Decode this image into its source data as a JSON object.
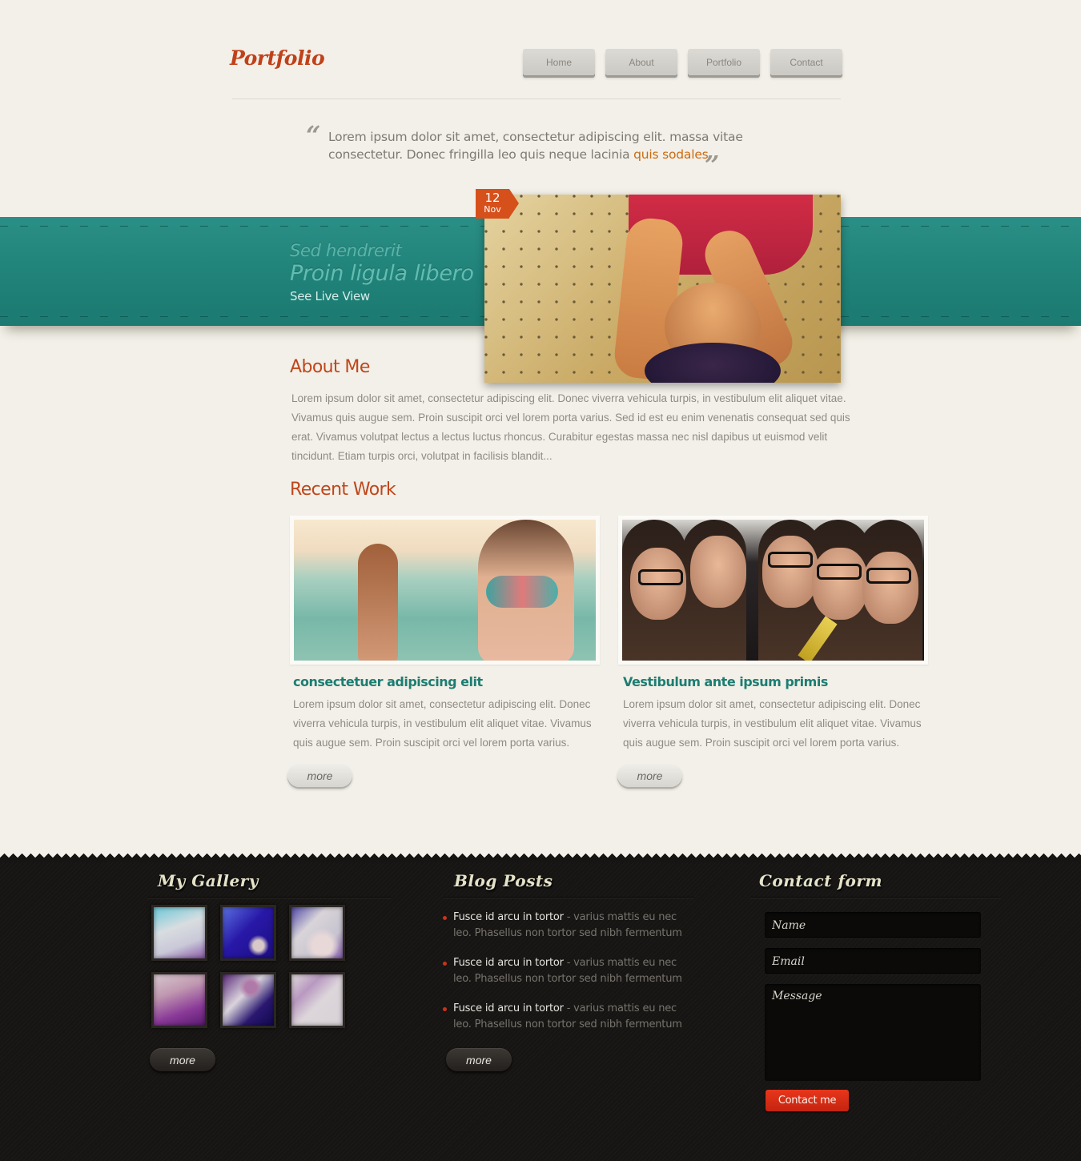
{
  "header": {
    "logo": "Portfolio",
    "nav": [
      {
        "label": "Home"
      },
      {
        "label": "About"
      },
      {
        "label": "Portfolio"
      },
      {
        "label": "Contact"
      }
    ]
  },
  "quote": {
    "open_mark": "“",
    "close_mark": "”",
    "text": "Lorem ipsum dolor sit amet, consectetur adipiscing elit. massa vitae consectetur. Donec fringilla leo quis neque lacinia ",
    "highlight": "quis sodales",
    "highlight_color": "#cc6a10"
  },
  "banner": {
    "subtitle": "Sed hendrerit",
    "title": "Proin ligula libero",
    "link": "See Live View",
    "color": "#1f8178"
  },
  "featured": {
    "date_day": "12",
    "date_month": "Nov",
    "image": "woman-lying-on-bed-with-headphones"
  },
  "about": {
    "title": "About Me",
    "text": "Lorem ipsum dolor sit amet, consectetur adipiscing elit. Donec viverra vehicula turpis, in vestibulum elit aliquet vitae. Vivamus quis augue sem. Proin suscipit orci vel lorem porta varius. Sed id est eu enim venenatis consequat sed quis erat.  Vivamus volutpat lectus a lectus luctus rhoncus. Curabitur egestas massa nec nisl dapibus ut euismod velit tincidunt. Etiam turpis orci, volutpat in facilisis blandit..."
  },
  "recent_work": {
    "title": "Recent Work",
    "items": [
      {
        "image": "two-women-at-beach",
        "title": "consectetuer adipiscing elit",
        "text": "Lorem ipsum dolor sit amet, consectetur adipiscing elit. Donec viverra vehicula turpis, in vestibulum elit aliquet vitae. Vivamus quis augue sem. Proin suscipit orci vel lorem porta varius.",
        "more": "more"
      },
      {
        "image": "group-with-glasses",
        "title": "Vestibulum ante ipsum primis",
        "text": "Lorem ipsum dolor sit amet, consectetur adipiscing elit. Donec viverra vehicula turpis, in vestibulum elit aliquet vitae. Vivamus quis augue sem. Proin suscipit orci vel lorem porta varius.",
        "more": "more"
      }
    ]
  },
  "footer": {
    "gallery": {
      "title": "My Gallery",
      "thumbs": [
        "gallery-1",
        "gallery-2",
        "gallery-3",
        "gallery-4",
        "gallery-5",
        "gallery-6"
      ],
      "more": "more"
    },
    "blog": {
      "title": "Blog Posts",
      "posts": [
        {
          "lead": "Fusce id arcu in tortor",
          "rest": " - varius mattis eu nec leo. Phasellus non tortor sed nibh fermentum"
        },
        {
          "lead": "Fusce id arcu in tortor",
          "rest": " - varius mattis eu nec leo. Phasellus non tortor sed nibh fermentum"
        },
        {
          "lead": "Fusce id arcu in tortor",
          "rest": " - varius mattis eu nec leo. Phasellus non tortor sed nibh fermentum"
        }
      ],
      "more": "more"
    },
    "contact": {
      "title": "Contact form",
      "name_placeholder": "Name",
      "email_placeholder": "Email",
      "message_placeholder": "Message",
      "submit": "Contact me",
      "submit_color": "#d62e16"
    }
  }
}
